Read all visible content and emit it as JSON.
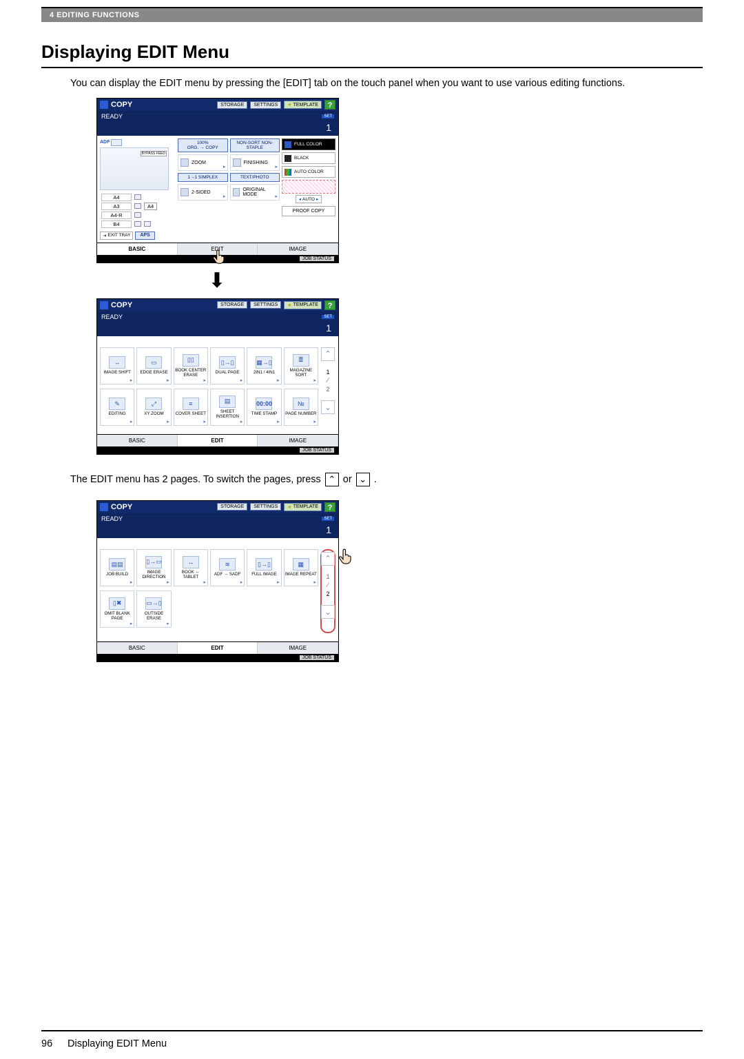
{
  "chapter_bar": "4  EDITING FUNCTIONS",
  "section_title": "Displaying EDIT Menu",
  "intro_text": "You can display the EDIT menu by pressing the [EDIT] tab on the touch panel when you want to use various editing functions.",
  "note_prefix": "The EDIT menu has 2 pages. To switch the pages, press ",
  "note_mid": " or ",
  "note_suffix": " .",
  "footer_page": "96",
  "footer_label": "Displaying EDIT Menu",
  "titlebar": {
    "title": "COPY",
    "storage": "STORAGE",
    "settings": "SETTINGS",
    "template": "TEMPLATE",
    "help": "?"
  },
  "status": {
    "ready": "READY",
    "set": "SET",
    "counter": "1"
  },
  "screen1": {
    "adf": "ADF",
    "bypass": "BYPASS FEED",
    "trays": [
      "A4",
      "A3",
      "A4-R",
      "B4"
    ],
    "tray_sel": "A4",
    "exit": "EXIT TRAY",
    "aps": "APS",
    "zoom_pct": "100%",
    "zoom_sub": "ORG. → COPY",
    "nonsort": "NON-SORT NON-STAPLE",
    "zoom": "ZOOM",
    "finishing": "FINISHING",
    "simplex": "1→1 SIMPLEX",
    "textphoto": "TEXT/PHOTO",
    "twosided": "2-SIDED",
    "origmode": "ORIGINAL MODE",
    "fullcolor": "FULL COLOR",
    "black": "BLACK",
    "autocolor": "AUTO COLOR",
    "auto": "AUTO",
    "proof": "PROOF COPY"
  },
  "bottom_tabs": {
    "basic": "BASIC",
    "edit": "EDIT",
    "image": "IMAGE"
  },
  "job_status": "JOB STATUS",
  "edit_p1": {
    "r1": [
      "IMAGE SHIFT",
      "EDGE ERASE",
      "BOOK CENTER ERASE",
      "DUAL PAGE",
      "2IN1 / 4IN1",
      "MAGAZINE SORT"
    ],
    "r2": [
      "EDITING",
      "XY ZOOM",
      "COVER SHEET",
      "SHEET INSERTION",
      "TIME STAMP",
      "PAGE NUMBER"
    ],
    "time_icon": "00:00",
    "page_labels": {
      "cur": "1",
      "other": "2"
    }
  },
  "edit_p2": {
    "r1": [
      "JOB BUILD",
      "IMAGE DIRECTION",
      "BOOK ↔ TABLET",
      "ADF → SADF",
      "FULL IMAGE",
      "IMAGE REPEAT"
    ],
    "r2": [
      "OMIT BLANK PAGE",
      "OUTSIDE ERASE",
      "",
      "",
      "",
      ""
    ],
    "page_labels": {
      "cur": "2",
      "other": "1"
    }
  }
}
